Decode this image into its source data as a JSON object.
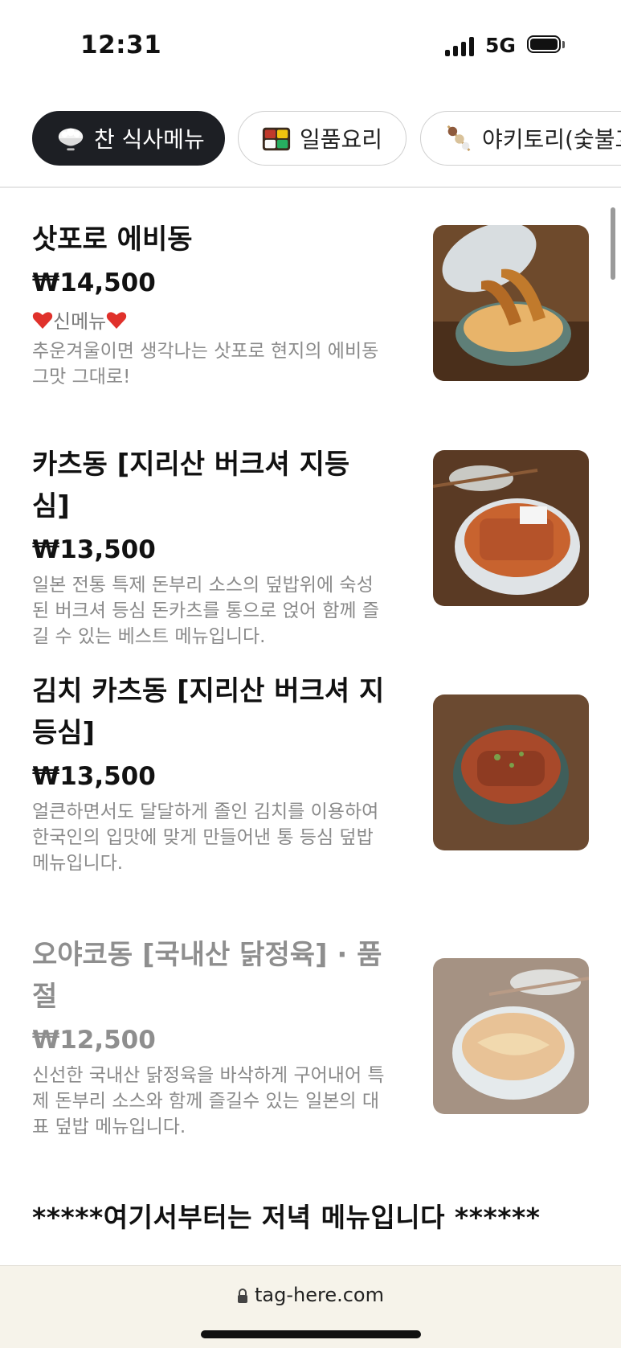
{
  "status_bar": {
    "time": "12:31",
    "network": "5G"
  },
  "tabs": [
    {
      "label": "찬 식사메뉴",
      "icon": "rice-bowl-icon",
      "active": true
    },
    {
      "label": "일품요리",
      "icon": "bento-box-icon",
      "active": false
    },
    {
      "label": "야키토리(숯불꼬",
      "icon": "skewer-icon",
      "active": false
    }
  ],
  "menu": [
    {
      "name": "삿포로 에비동",
      "price": "₩14,500",
      "badge": "신메뉴",
      "description": "추운겨울이면 생각나는 삿포로 현지의 에비동 그맛 그대로!",
      "sold_out": false
    },
    {
      "name": "카츠동 [지리산 버크셔 지등심]",
      "price": "₩13,500",
      "description": "일본 전통 특제 돈부리 소스의 덮밥위에 숙성된 버크셔 등심 돈카츠를 통으로 얹어 함께 즐길 수 있는 베스트 메뉴입니다.",
      "sold_out": false
    },
    {
      "name": "김치 카츠동 [지리산 버크셔 지등심]",
      "price": "₩13,500",
      "description": "얼큰하면서도 달달하게 졸인 김치를 이용하여 한국인의 입맛에 맞게 만들어낸 통 등심 덮밥 메뉴입니다.",
      "sold_out": false
    },
    {
      "name": "오야코동 [국내산 닭정육] · 품절",
      "price": "₩12,500",
      "description": "신선한 국내산 닭정육을 바삭하게 구어내어 특제 돈부리 소스와 함께 즐길수 있는 일본의 대표 덮밥 메뉴입니다.",
      "sold_out": true
    }
  ],
  "section_notice": "*****여기서부터는 저녁 메뉴입니다 ******",
  "browser": {
    "url": "tag-here.com"
  },
  "colors": {
    "active_tab_bg": "#1d1f24",
    "url_bar_bg": "#f6f3ea",
    "muted_text": "#8a8a8a"
  }
}
